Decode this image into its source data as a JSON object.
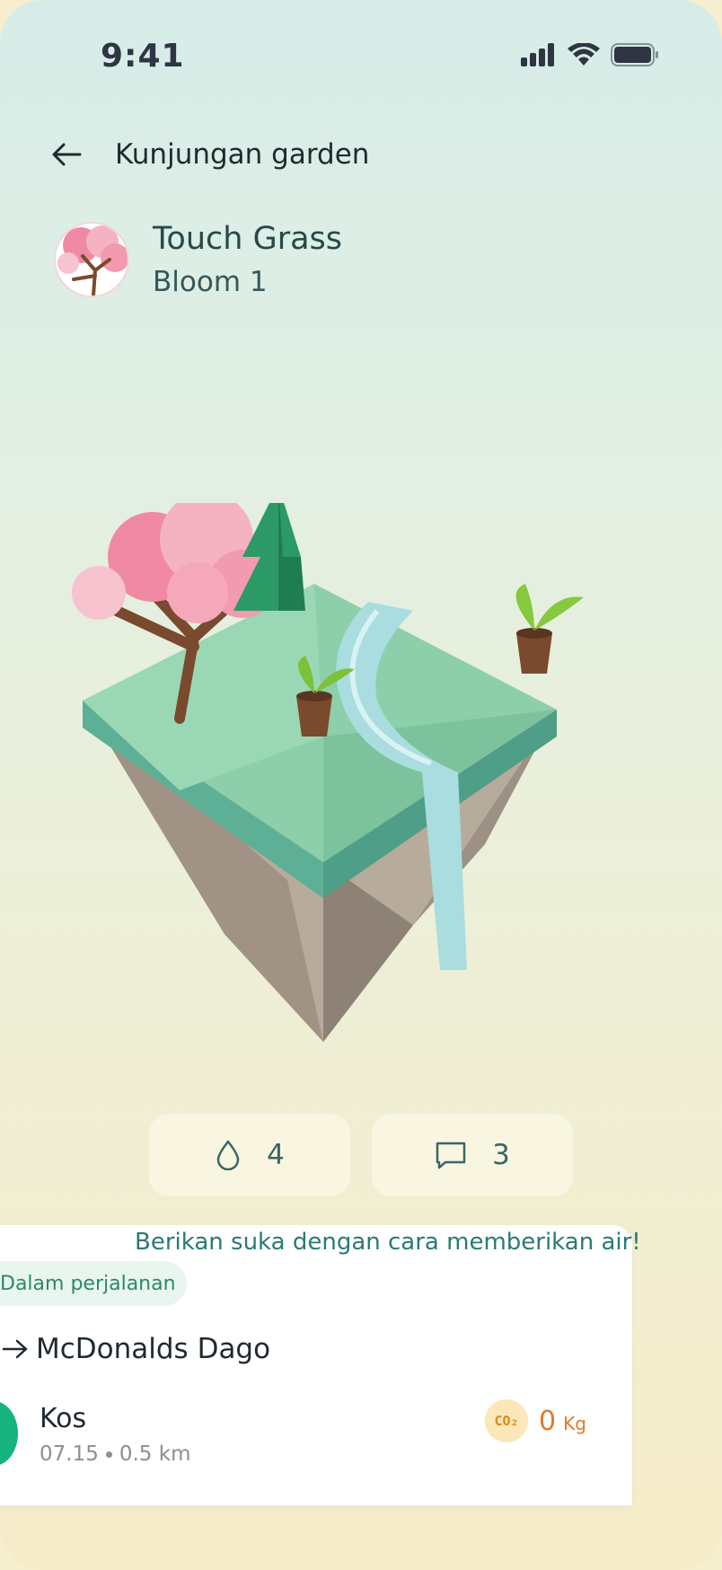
{
  "status_bar": {
    "time": "9:41"
  },
  "header": {
    "title": "Kunjungan garden"
  },
  "profile": {
    "name": "Touch Grass",
    "subtitle": "Bloom 1"
  },
  "stats": {
    "water_count": "4",
    "comment_count": "3"
  },
  "card": {
    "hint": "Berikan suka dengan cara memberikan air!",
    "status_pill": "Dalam perjalanan",
    "destination": "McDonalds Dago",
    "origin": "Kos",
    "time": "07.15",
    "distance": "0.5 km",
    "co2_badge": "CO₂",
    "co2_value": "0",
    "co2_unit": "Kg"
  },
  "colors": {
    "accent": "#17b47f",
    "teal_text": "#2b7a74",
    "co2_orange": "#e07a2a"
  },
  "icons": [
    "back-arrow-icon",
    "signal-icon",
    "wifi-icon",
    "battery-icon",
    "water-drop-icon",
    "comment-icon",
    "arrow-right-icon",
    "co2-icon"
  ]
}
